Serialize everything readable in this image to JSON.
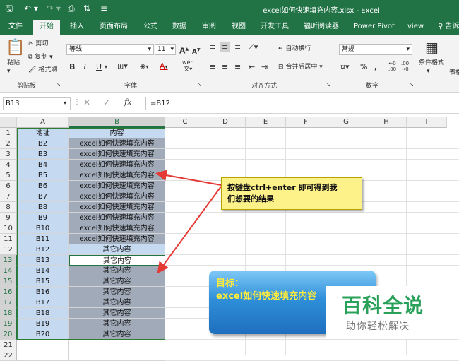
{
  "window": {
    "title": "excel如何快速填充内容.xlsx - Excel"
  },
  "tabs": [
    "文件",
    "开始",
    "插入",
    "页面布局",
    "公式",
    "数据",
    "审阅",
    "视图",
    "开发工具",
    "福昕阅读器",
    "Power Pivot",
    "view",
    "告诉"
  ],
  "ribbon": {
    "clipboard": {
      "paste": "粘贴",
      "cut": "剪切",
      "copy": "复制 ▾",
      "format_painter": "格式刷",
      "label": "剪贴板"
    },
    "font": {
      "name": "等线",
      "size": "11",
      "grow": "A",
      "shrink": "A",
      "bold": "B",
      "italic": "I",
      "underline": "U",
      "wen": "wén",
      "label": "字体"
    },
    "align": {
      "wrap": "自动换行",
      "merge": "合并后居中 ▾",
      "label": "对齐方式"
    },
    "number": {
      "format": "常规",
      "percent": "%",
      "comma": ",",
      "label": "数字"
    },
    "styles": {
      "cond": "条件格式",
      "table": "表格"
    }
  },
  "formula_bar": {
    "name_box": "B13",
    "fx": "fx",
    "formula": "=B12"
  },
  "columns": [
    "A",
    "B",
    "C",
    "D",
    "E",
    "F",
    "G",
    "H",
    "I"
  ],
  "rows": [
    {
      "n": "1",
      "a": "地址",
      "b": "内容"
    },
    {
      "n": "2",
      "a": "B2",
      "b": "excel如何快速填充内容"
    },
    {
      "n": "3",
      "a": "B3",
      "b": "excel如何快速填充内容"
    },
    {
      "n": "4",
      "a": "B4",
      "b": "excel如何快速填充内容"
    },
    {
      "n": "5",
      "a": "B5",
      "b": "excel如何快速填充内容"
    },
    {
      "n": "6",
      "a": "B6",
      "b": "excel如何快速填充内容"
    },
    {
      "n": "7",
      "a": "B7",
      "b": "excel如何快速填充内容"
    },
    {
      "n": "8",
      "a": "B8",
      "b": "excel如何快速填充内容"
    },
    {
      "n": "9",
      "a": "B9",
      "b": "excel如何快速填充内容"
    },
    {
      "n": "10",
      "a": "B10",
      "b": "excel如何快速填充内容"
    },
    {
      "n": "11",
      "a": "B11",
      "b": "excel如何快速填充内容"
    },
    {
      "n": "12",
      "a": "B12",
      "b": "其它内容"
    },
    {
      "n": "13",
      "a": "B13",
      "b": "其它内容"
    },
    {
      "n": "14",
      "a": "B14",
      "b": "其它内容"
    },
    {
      "n": "15",
      "a": "B15",
      "b": "其它内容"
    },
    {
      "n": "16",
      "a": "B16",
      "b": "其它内容"
    },
    {
      "n": "17",
      "a": "B17",
      "b": "其它内容"
    },
    {
      "n": "18",
      "a": "B18",
      "b": "其它内容"
    },
    {
      "n": "19",
      "a": "B19",
      "b": "其它内容"
    },
    {
      "n": "20",
      "a": "B20",
      "b": "其它内容"
    },
    {
      "n": "21",
      "a": "",
      "b": ""
    },
    {
      "n": "22",
      "a": "",
      "b": ""
    }
  ],
  "callout": {
    "line1": "按键盘ctrl+enter 即可得到我",
    "line2": "们想要的结果"
  },
  "goal": {
    "line1": "目标：",
    "line2": "excel如何快速填充内容"
  },
  "watermark": {
    "line1": "百科全说",
    "line2": "助你轻松解决"
  },
  "colors": {
    "excel_green": "#217346",
    "highlight": "#c5d9f1",
    "selection_dark": "#a0aab8",
    "arrow": "#e53935"
  }
}
